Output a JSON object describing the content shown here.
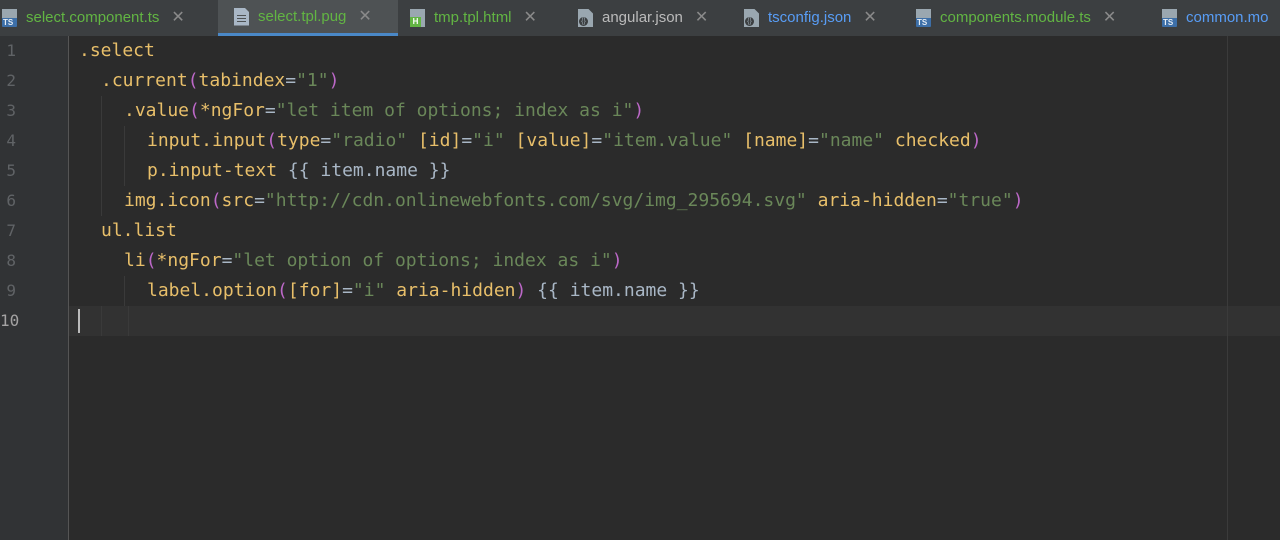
{
  "tabs": [
    {
      "label": "select.component.ts",
      "icon": "typescript-file-icon",
      "color": "#62b543",
      "active": false,
      "closable": true
    },
    {
      "label": "select.tpl.pug",
      "icon": "pug-file-icon",
      "color": "#62b543",
      "active": true,
      "closable": true
    },
    {
      "label": "tmp.tpl.html",
      "icon": "html-file-icon",
      "color": "#62b543",
      "active": false,
      "closable": true
    },
    {
      "label": "angular.json",
      "icon": "json-file-icon",
      "color": "#bbbbbb",
      "active": false,
      "closable": true
    },
    {
      "label": "tsconfig.json",
      "icon": "json-file-icon",
      "color": "#589df6",
      "active": false,
      "closable": true
    },
    {
      "label": "components.module.ts",
      "icon": "typescript-file-icon",
      "color": "#62b543",
      "active": false,
      "closable": true
    },
    {
      "label": "common.mo",
      "icon": "typescript-file-icon",
      "color": "#589df6",
      "active": false,
      "closable": false
    }
  ],
  "close_glyph": "✕",
  "ts_badge": "TS",
  "html_badge": "H",
  "json_badge": "{}",
  "line_numbers": [
    "1",
    "2",
    "3",
    "4",
    "5",
    "6",
    "7",
    "8",
    "9",
    "10"
  ],
  "current_line": "10",
  "colors": {
    "selector": "#e8bf6a",
    "string": "#6a8759",
    "paren": "#bc68c8",
    "plain": "#a9b7c6",
    "active_tab_underline": "#4a88c7"
  },
  "code": [
    [
      {
        "t": ".select",
        "k": "sel"
      }
    ],
    [
      {
        "t": ".current",
        "k": "sel"
      },
      {
        "t": "(",
        "k": "par"
      },
      {
        "t": "tabindex",
        "k": "attr"
      },
      {
        "t": "=",
        "k": "plain"
      },
      {
        "t": "\"1\"",
        "k": "str"
      },
      {
        "t": ")",
        "k": "par"
      }
    ],
    [
      {
        "t": ".value",
        "k": "sel"
      },
      {
        "t": "(",
        "k": "par"
      },
      {
        "t": "*ngFor",
        "k": "attr"
      },
      {
        "t": "=",
        "k": "plain"
      },
      {
        "t": "\"let item of options; index as i\"",
        "k": "str"
      },
      {
        "t": ")",
        "k": "par"
      }
    ],
    [
      {
        "t": "input.input",
        "k": "sel"
      },
      {
        "t": "(",
        "k": "par"
      },
      {
        "t": "type",
        "k": "attr"
      },
      {
        "t": "=",
        "k": "plain"
      },
      {
        "t": "\"radio\"",
        "k": "str"
      },
      {
        "t": " ",
        "k": "plain"
      },
      {
        "t": "[id]",
        "k": "attr"
      },
      {
        "t": "=",
        "k": "plain"
      },
      {
        "t": "\"i\"",
        "k": "str"
      },
      {
        "t": " ",
        "k": "plain"
      },
      {
        "t": "[value]",
        "k": "attr"
      },
      {
        "t": "=",
        "k": "plain"
      },
      {
        "t": "\"item.value\"",
        "k": "str"
      },
      {
        "t": " ",
        "k": "plain"
      },
      {
        "t": "[name]",
        "k": "attr"
      },
      {
        "t": "=",
        "k": "plain"
      },
      {
        "t": "\"name\"",
        "k": "str"
      },
      {
        "t": " ",
        "k": "plain"
      },
      {
        "t": "checked",
        "k": "attr"
      },
      {
        "t": ")",
        "k": "par"
      }
    ],
    [
      {
        "t": "p.input-text",
        "k": "sel"
      },
      {
        "t": " {{ item.name }}",
        "k": "plain"
      }
    ],
    [
      {
        "t": "img.icon",
        "k": "sel"
      },
      {
        "t": "(",
        "k": "par"
      },
      {
        "t": "src",
        "k": "attr"
      },
      {
        "t": "=",
        "k": "plain"
      },
      {
        "t": "\"http://cdn.onlinewebfonts.com/svg/img_295694.svg\"",
        "k": "str"
      },
      {
        "t": " ",
        "k": "plain"
      },
      {
        "t": "aria-hidden",
        "k": "attr"
      },
      {
        "t": "=",
        "k": "plain"
      },
      {
        "t": "\"true\"",
        "k": "str"
      },
      {
        "t": ")",
        "k": "par"
      }
    ],
    [
      {
        "t": "ul.list",
        "k": "sel"
      }
    ],
    [
      {
        "t": "li",
        "k": "sel"
      },
      {
        "t": "(",
        "k": "par"
      },
      {
        "t": "*ngFor",
        "k": "attr"
      },
      {
        "t": "=",
        "k": "plain"
      },
      {
        "t": "\"let option of options; index as i\"",
        "k": "str"
      },
      {
        "t": ")",
        "k": "par"
      }
    ],
    [
      {
        "t": "label.option",
        "k": "sel"
      },
      {
        "t": "(",
        "k": "par"
      },
      {
        "t": "[for]",
        "k": "attr"
      },
      {
        "t": "=",
        "k": "plain"
      },
      {
        "t": "\"i\"",
        "k": "str"
      },
      {
        "t": " ",
        "k": "plain"
      },
      {
        "t": "aria-hidden",
        "k": "attr"
      },
      {
        "t": ")",
        "k": "par"
      },
      {
        "t": " {{ item.name }}",
        "k": "plain"
      }
    ],
    []
  ]
}
